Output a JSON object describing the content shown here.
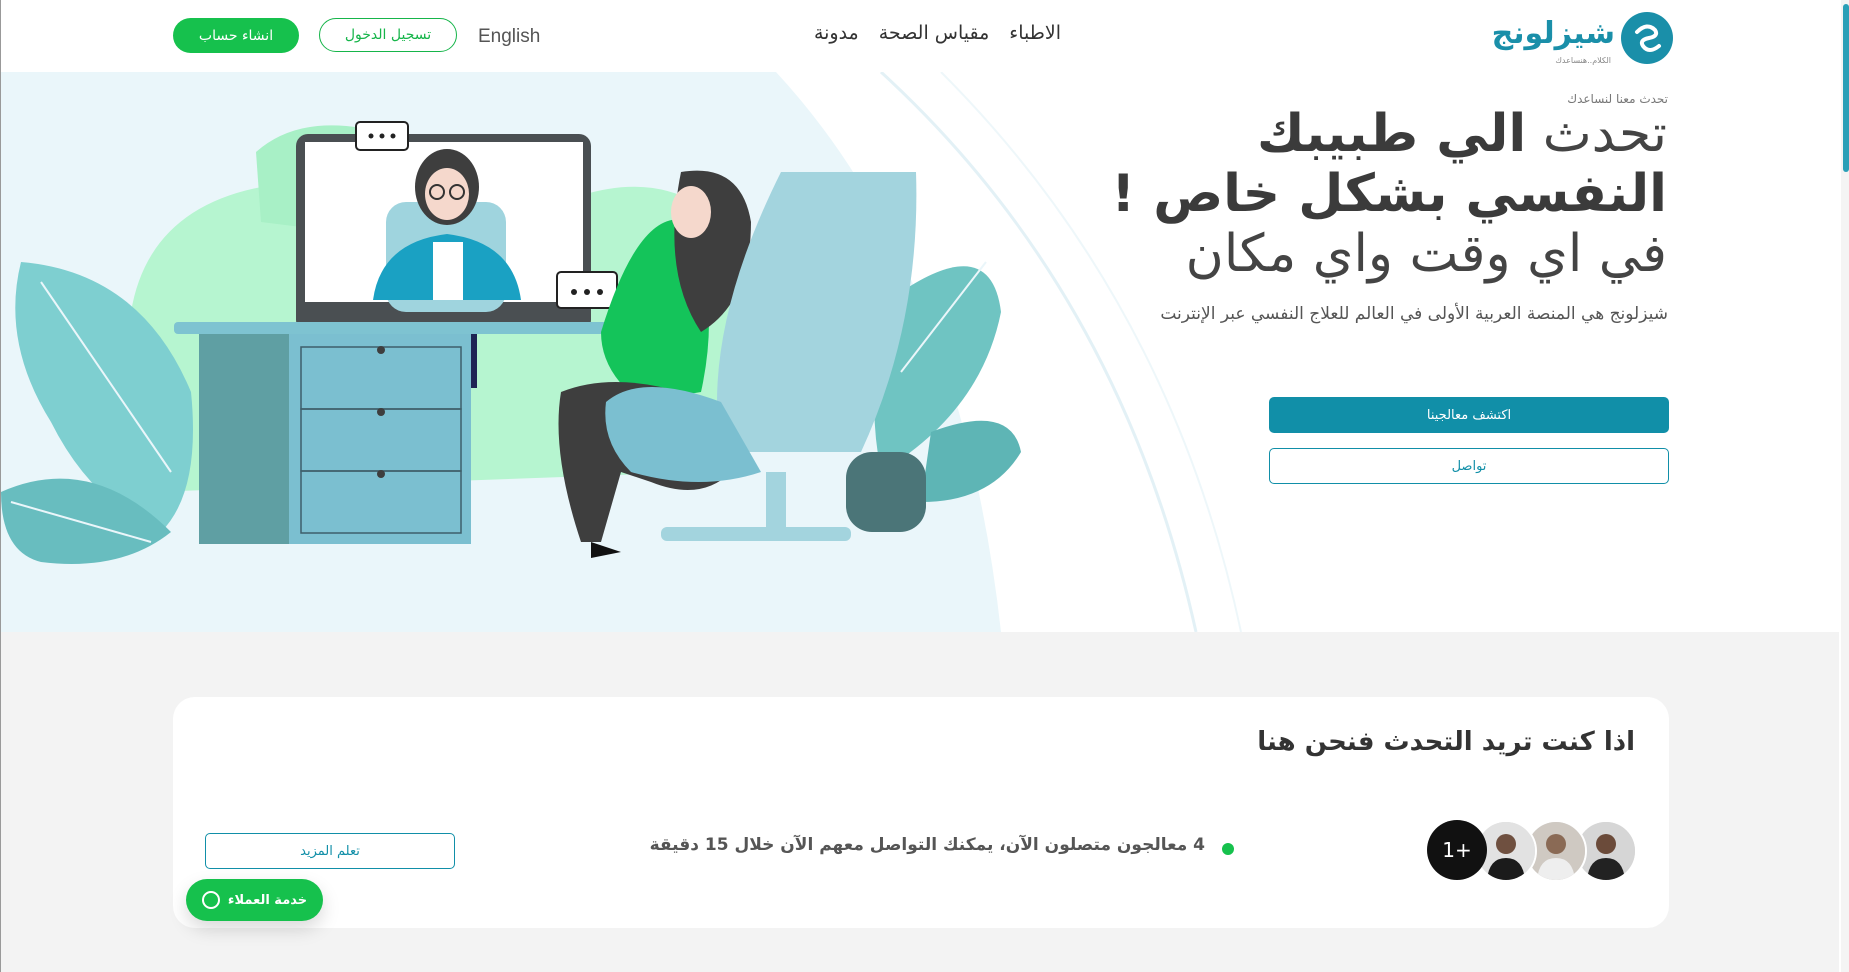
{
  "brand": {
    "name": "شيزلونج",
    "tagline": "الكلام..هنساعدك",
    "accent": "#118fa8",
    "green": "#16c14d"
  },
  "nav": {
    "items": [
      "الاطباء",
      "مقياس الصحة",
      "مدونة"
    ],
    "language": "English",
    "login": "تسجيل الدخول",
    "signup": "انشاء حساب"
  },
  "hero": {
    "kicker": "تحدث معنا لنساعدك",
    "line1_light": "تحدث",
    "line1_bold": "الي طبيبك",
    "line2": "النفسي بشكل خاص !",
    "line3": "في اي وقت واي مكان",
    "subtitle": "شيزلونج هي المنصة العربية الأولى في العالم للعلاج النفسي عبر الإنترنت",
    "primary_button": "اكتشف معالجينا",
    "secondary_button": "تواصل"
  },
  "talk_card": {
    "title": "اذا كنت تريد التحدث فنحن هنا",
    "online_text": "4 معالجون متصلون الآن، يمكنك التواصل معهم الآن خلال 15 دقيقة",
    "more_count": "1+",
    "learn_more": "تعلم المزيد"
  },
  "support": {
    "label": "خدمة العملاء",
    "icon": "headset-icon"
  }
}
